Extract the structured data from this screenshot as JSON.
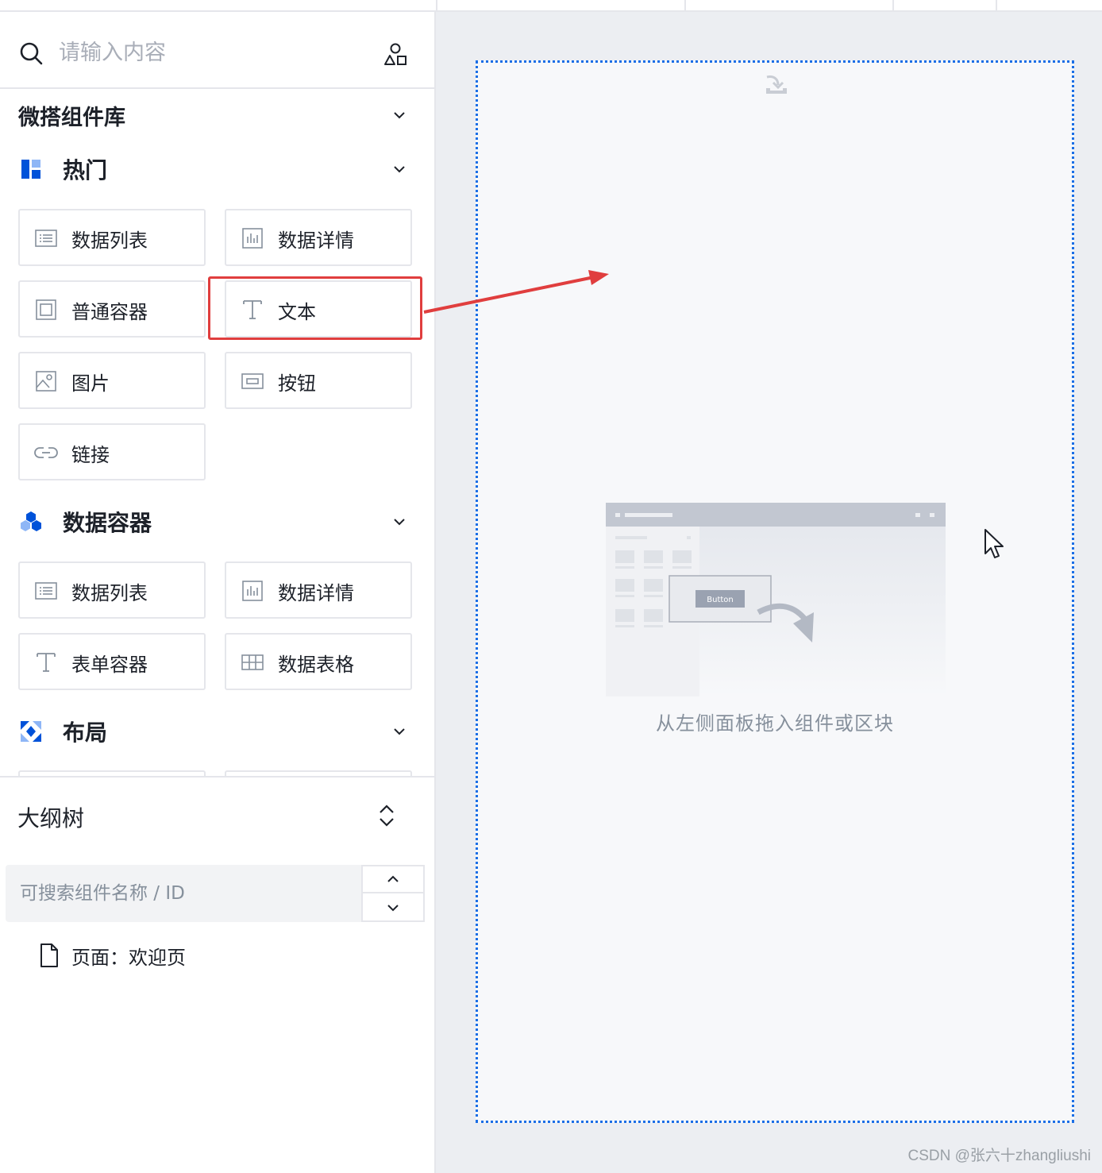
{
  "search": {
    "placeholder": "请输入内容"
  },
  "library": {
    "title": "微搭组件库",
    "categories": [
      {
        "title": "热门",
        "items": [
          {
            "label": "数据列表",
            "icon": "list-icon"
          },
          {
            "label": "数据详情",
            "icon": "detail-chart-icon"
          },
          {
            "label": "普通容器",
            "icon": "container-icon"
          },
          {
            "label": "文本",
            "icon": "text-icon"
          },
          {
            "label": "图片",
            "icon": "image-icon"
          },
          {
            "label": "按钮",
            "icon": "button-icon"
          },
          {
            "label": "链接",
            "icon": "link-icon"
          }
        ]
      },
      {
        "title": "数据容器",
        "items": [
          {
            "label": "数据列表",
            "icon": "list-icon"
          },
          {
            "label": "数据详情",
            "icon": "detail-chart-icon"
          },
          {
            "label": "表单容器",
            "icon": "text-icon"
          },
          {
            "label": "数据表格",
            "icon": "table-icon"
          }
        ]
      },
      {
        "title": "布局",
        "items": []
      }
    ]
  },
  "outline": {
    "title": "大纲树",
    "search_placeholder": "可搜索组件名称 / ID",
    "tree": [
      {
        "label": "页面：欢迎页"
      }
    ]
  },
  "canvas": {
    "empty_hint": "从左侧面板拖入组件或区块",
    "illustration_button_label": "Button"
  },
  "watermark": "CSDN @张六十zhangliushi",
  "colors": {
    "accent": "#1a6ee6",
    "annotation_red": "#e03e3e",
    "border": "#e5e6eb",
    "canvas_bg": "#eceef2"
  }
}
